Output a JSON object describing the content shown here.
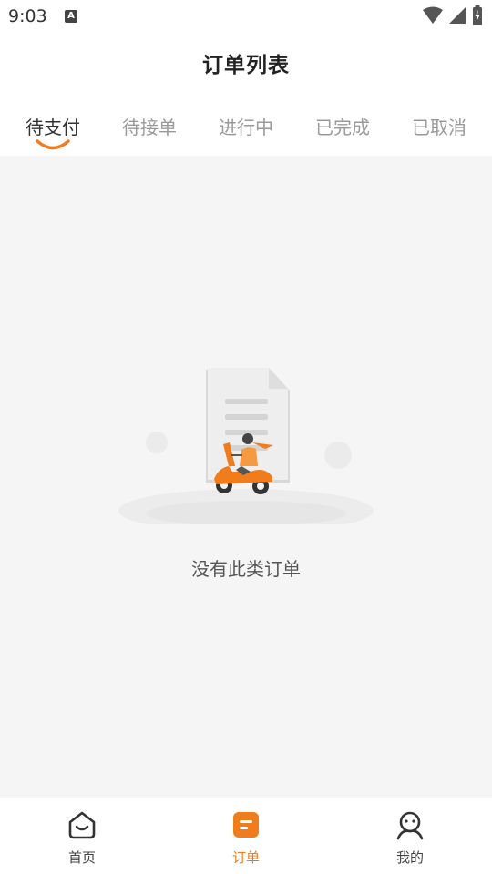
{
  "status_bar": {
    "time": "9:03",
    "notification_icon": "A"
  },
  "header": {
    "title": "订单列表"
  },
  "tabs": [
    {
      "label": "待支付",
      "active": true
    },
    {
      "label": "待接单",
      "active": false
    },
    {
      "label": "进行中",
      "active": false
    },
    {
      "label": "已完成",
      "active": false
    },
    {
      "label": "已取消",
      "active": false
    }
  ],
  "empty_state": {
    "message": "没有此类订单",
    "illustration": "document-with-scooter-rider"
  },
  "bottom_nav": [
    {
      "label": "首页",
      "icon": "home-icon",
      "active": false
    },
    {
      "label": "订单",
      "icon": "order-icon",
      "active": true
    },
    {
      "label": "我的",
      "icon": "profile-icon",
      "active": false
    }
  ],
  "colors": {
    "accent": "#f07c1c",
    "background": "#f5f5f5",
    "active_text": "#333333",
    "inactive_text": "#999999"
  }
}
